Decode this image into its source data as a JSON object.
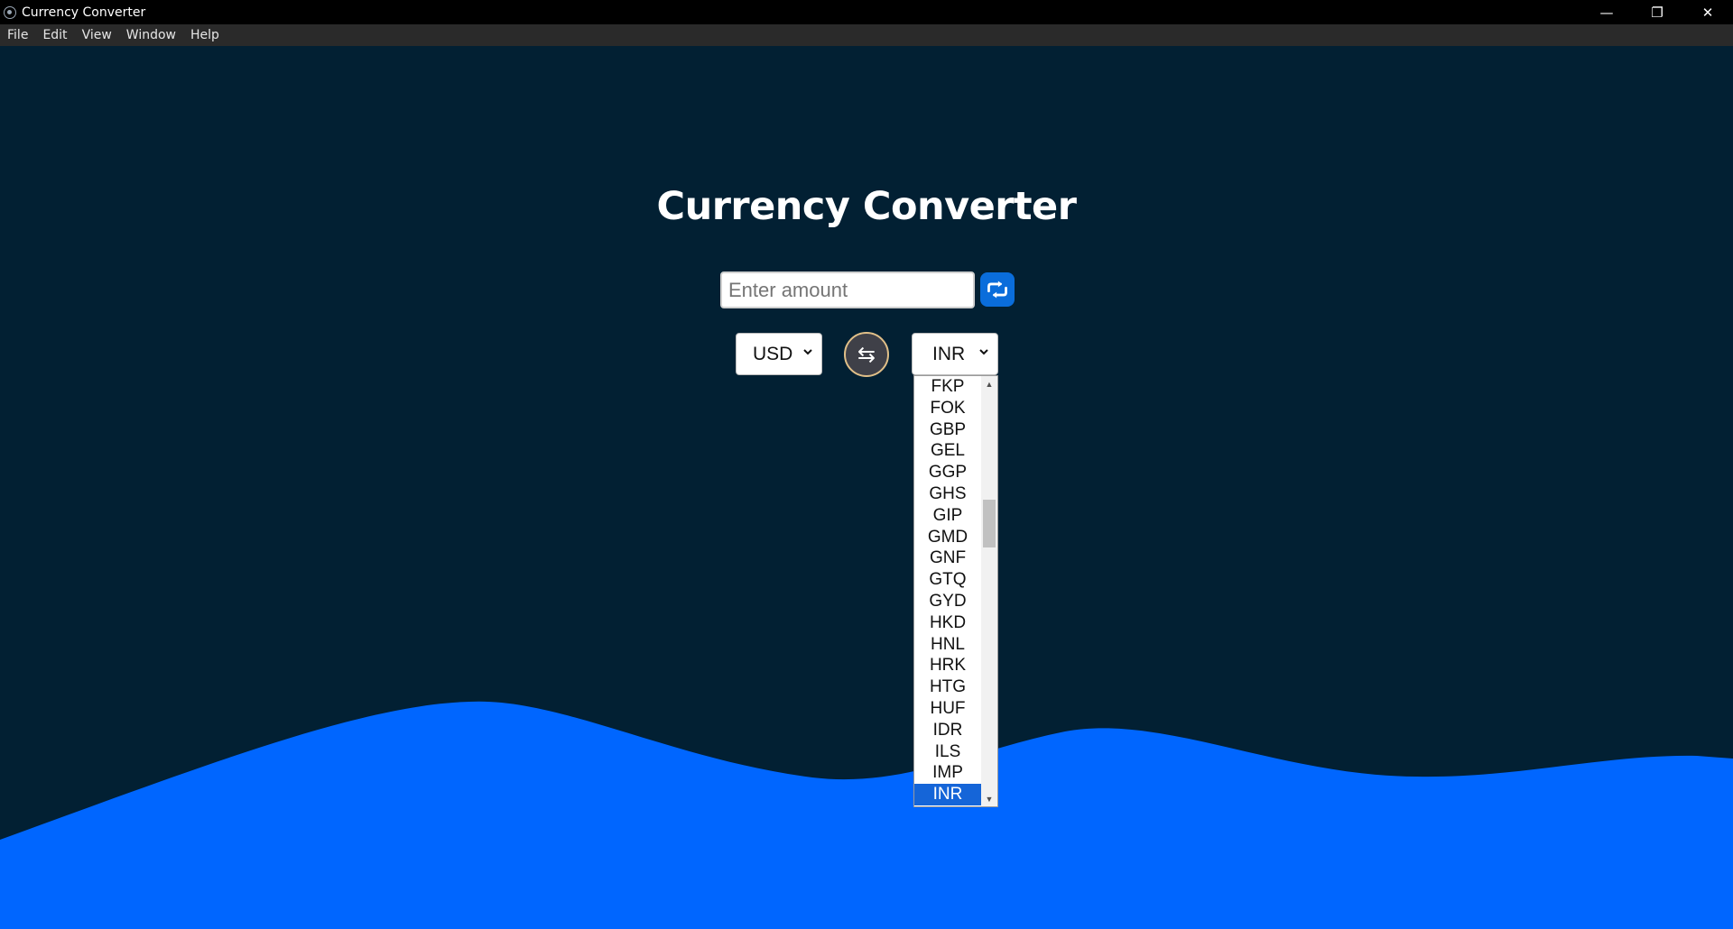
{
  "window": {
    "title": "Currency Converter",
    "controls": {
      "minimize": "—",
      "restore": "❐",
      "close": "✕"
    }
  },
  "menu": [
    "File",
    "Edit",
    "View",
    "Window",
    "Help"
  ],
  "app": {
    "heading": "Currency Converter",
    "amount": {
      "value": "",
      "placeholder": "Enter amount"
    },
    "convert_icon": "convert-arrows-icon",
    "from_currency": "USD",
    "swap_symbol": "⇆",
    "to_currency": "INR"
  },
  "dropdown": {
    "options": [
      "FKP",
      "FOK",
      "GBP",
      "GEL",
      "GGP",
      "GHS",
      "GIP",
      "GMD",
      "GNF",
      "GTQ",
      "GYD",
      "HKD",
      "HNL",
      "HRK",
      "HTG",
      "HUF",
      "IDR",
      "ILS",
      "IMP",
      "INR"
    ],
    "selected": "INR",
    "scroll_up": "▲",
    "scroll_down": "▼"
  },
  "colors": {
    "background": "#022033",
    "wave": "#0066FF",
    "accent_button": "#0A6DDB",
    "swap_border": "#E0BF88",
    "selected_option": "#1565D8"
  }
}
